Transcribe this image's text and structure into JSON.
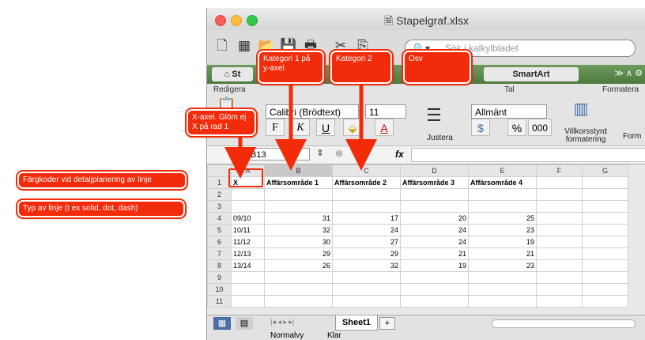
{
  "window": {
    "title": "Stapelgraf.xlsx"
  },
  "colors": {
    "annotation": "#f22b0a",
    "ribbon_tabs": "#5a8a4a"
  },
  "toolbar": {
    "icons": [
      "new-icon",
      "gallery-icon",
      "open-icon",
      "save-icon",
      "print-icon",
      "cut-icon",
      "copy-icon"
    ],
    "search_placeholder": "Sök i kalkylbladet"
  },
  "tabs": {
    "home_glyph": "⌂",
    "home": "St",
    "smartart": "SmartArt",
    "arrows": "≫ ∧ ⚙"
  },
  "ribbon": {
    "group_font": "Redigera",
    "font_name": "Calibri (Brödtext)",
    "font_size": "11",
    "bold": "F",
    "italic": "K",
    "underline": "U",
    "align_group": "Justera",
    "number_group": "Tal",
    "number_format": "Allmänt",
    "percent": "%",
    "thousands": "000",
    "styles_group": "Formatera",
    "conditional": "Villkorsstyrd formatering",
    "format_short": "Form"
  },
  "formula_bar": {
    "cell": "B13",
    "fx": "fx"
  },
  "sheet": {
    "columns": [
      "A",
      "B",
      "C",
      "D",
      "E",
      "F",
      "G"
    ],
    "rows": [
      [
        "X",
        "Affärsområde 1",
        "Affärsområde 2",
        "Affärsområde 3",
        "Affärsområde 4",
        "",
        ""
      ],
      [
        "",
        "",
        "",
        "",
        "",
        "",
        ""
      ],
      [
        "",
        "",
        "",
        "",
        "",
        "",
        ""
      ],
      [
        "09/10",
        "31",
        "17",
        "20",
        "25",
        "",
        ""
      ],
      [
        "10/11",
        "32",
        "24",
        "24",
        "23",
        "",
        ""
      ],
      [
        "11/12",
        "30",
        "27",
        "24",
        "19",
        "",
        ""
      ],
      [
        "12/13",
        "29",
        "29",
        "21",
        "21",
        "",
        ""
      ],
      [
        "13/14",
        "26",
        "32",
        "19",
        "23",
        "",
        ""
      ],
      [
        "",
        "",
        "",
        "",
        "",
        "",
        ""
      ],
      [
        "",
        "",
        "",
        "",
        "",
        "",
        ""
      ],
      [
        "",
        "",
        "",
        "",
        "",
        "",
        ""
      ]
    ],
    "tab_name": "Sheet1"
  },
  "statusbar": {
    "view": "Normalvy",
    "status": "Klar"
  },
  "annotations": {
    "kategori1": "Kategori 1 på y-axel",
    "kategori2": "Kategori 2",
    "osv": "Osv",
    "xaxel": "X-axel. Glöm ej X på rad 1",
    "fargkoder": "Färgkoder vid detaljplanering av linje",
    "typ": "Typ av linje (t ex solid, dot, dash)"
  }
}
